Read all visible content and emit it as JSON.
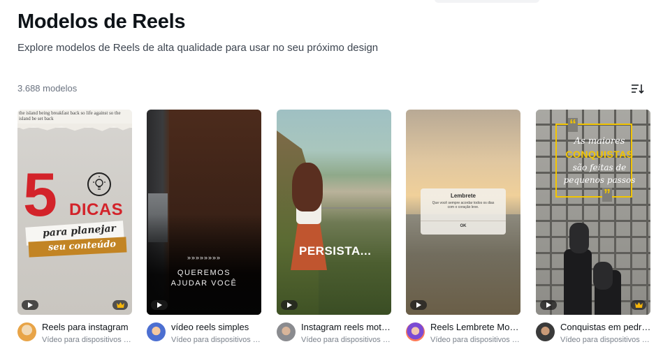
{
  "header": {
    "title": "Modelos de Reels",
    "subtitle": "Explore modelos de Reels de alta qualidade para usar no seu próximo design"
  },
  "results": {
    "count": "3.688 modelos",
    "sort_icon": "sort-icon"
  },
  "cards": [
    {
      "title": "Reels para instagram",
      "subtitle": "Vídeo para dispositivos móveis",
      "premium": true,
      "thumb": {
        "strip": "the island being breakfast back so life against so the island be set back",
        "big": "5",
        "word": "DICAS",
        "line1": "para planejar",
        "line2": "seu conteúdo"
      }
    },
    {
      "title": "vídeo reels simples",
      "subtitle": "Vídeo para dispositivos móveis",
      "premium": false,
      "thumb": {
        "arrows": "»»»»»»»»",
        "line1": "QUEREMOS",
        "line2": "AJUDAR VOCÊ"
      }
    },
    {
      "title": "Instagram reels motivação",
      "subtitle": "Vídeo para dispositivos móveis",
      "premium": false,
      "thumb": {
        "caption": "PERSISTA..."
      }
    },
    {
      "title": "Reels Lembrete Motivacional",
      "subtitle": "Vídeo para dispositivos móveis",
      "premium": false,
      "thumb": {
        "dialog_title": "Lembrete",
        "dialog_body": "Que você sempre acordar todos os dias com o coração leve.",
        "dialog_button": "OK"
      }
    },
    {
      "title": "Conquistas em pedras",
      "subtitle": "Vídeo para dispositivos móveis",
      "premium": true,
      "thumb": {
        "line1": "As maiores",
        "line2": "CONQUISTAS",
        "line3": "são feitas de",
        "line4": "pequenos passos"
      }
    }
  ],
  "colors": {
    "accent_red": "#d3232a",
    "accent_gold": "#c28424",
    "quote_yellow": "#f2c500",
    "text_primary": "#0e1318",
    "text_secondary": "#7a818b"
  }
}
